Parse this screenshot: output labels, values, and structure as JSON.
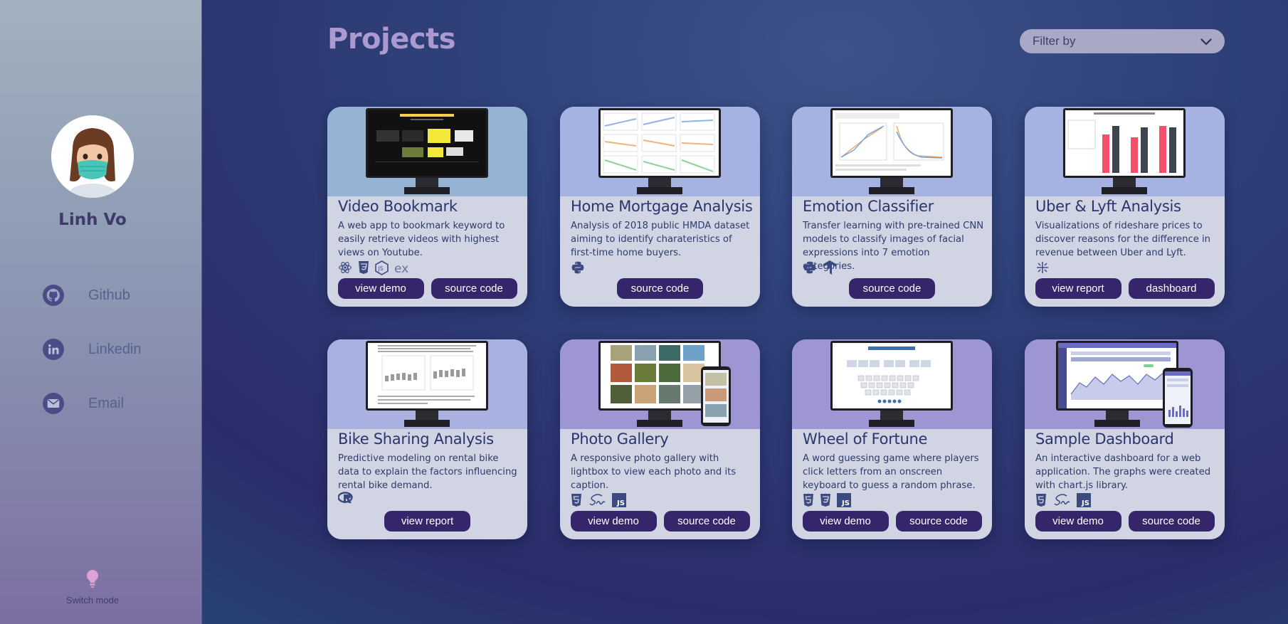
{
  "sidebar": {
    "name": "Linh Vo",
    "links": [
      {
        "label": "Github",
        "icon": "github-icon"
      },
      {
        "label": "Linkedin",
        "icon": "linkedin-icon"
      },
      {
        "label": "Email",
        "icon": "email-icon"
      }
    ],
    "switch_mode_label": "Switch mode"
  },
  "header": {
    "title": "Projects",
    "filter_label": "Filter by"
  },
  "colors": {
    "button": "#35266b",
    "title_accent": "#ab9ad0",
    "card_background": "#d1d5e3"
  },
  "projects": [
    {
      "title": "Video Bookmark",
      "description": "A web app to bookmark keyword to easily retrieve videos with highest views on Youtube.",
      "tech": [
        "react-icon",
        "css3-icon",
        "nodejs-icon",
        "express-icon"
      ],
      "tech_text": "ex",
      "buttons": [
        "view demo",
        "source code"
      ]
    },
    {
      "title": "Home Mortgage Analysis",
      "description": "Analysis of 2018 public HMDA dataset aiming to identify charateristics of first-time home buyers.",
      "tech": [
        "python-icon"
      ],
      "buttons": [
        "source code"
      ]
    },
    {
      "title": "Emotion Classifier",
      "description": "Transfer learning with pre-trained CNN models to classify images of facial expressions into 7 emotion categories.",
      "tech": [
        "python-icon",
        "tensorflow-icon"
      ],
      "buttons": [
        "source code"
      ]
    },
    {
      "title": "Uber & Lyft Analysis",
      "description": "Visualizations of rideshare prices to discover reasons for the difference in revenue between Uber and Lyft.",
      "tech": [
        "tableau-icon"
      ],
      "buttons": [
        "view report",
        "dashboard"
      ]
    },
    {
      "title": "Bike Sharing Analysis",
      "description": "Predictive modeling on rental bike data to explain the factors influencing rental bike demand.",
      "tech": [
        "r-icon"
      ],
      "buttons": [
        "view report"
      ]
    },
    {
      "title": "Photo Gallery",
      "description": "A responsive photo gallery with lightbox to view each photo and its caption.",
      "tech": [
        "html5-icon",
        "sass-icon",
        "javascript-icon"
      ],
      "buttons": [
        "view demo",
        "source code"
      ]
    },
    {
      "title": "Wheel of Fortune",
      "description": "A word guessing game where players click letters from an onscreen keyboard to guess a random phrase.",
      "tech": [
        "html5-icon",
        "css3-icon",
        "javascript-icon"
      ],
      "buttons": [
        "view demo",
        "source code"
      ]
    },
    {
      "title": "Sample Dashboard",
      "description": "An interactive dashboard for a web application. The graphs were created with chart.js library.",
      "tech": [
        "html5-icon",
        "sass-icon",
        "javascript-icon"
      ],
      "buttons": [
        "view demo",
        "source code"
      ]
    }
  ]
}
